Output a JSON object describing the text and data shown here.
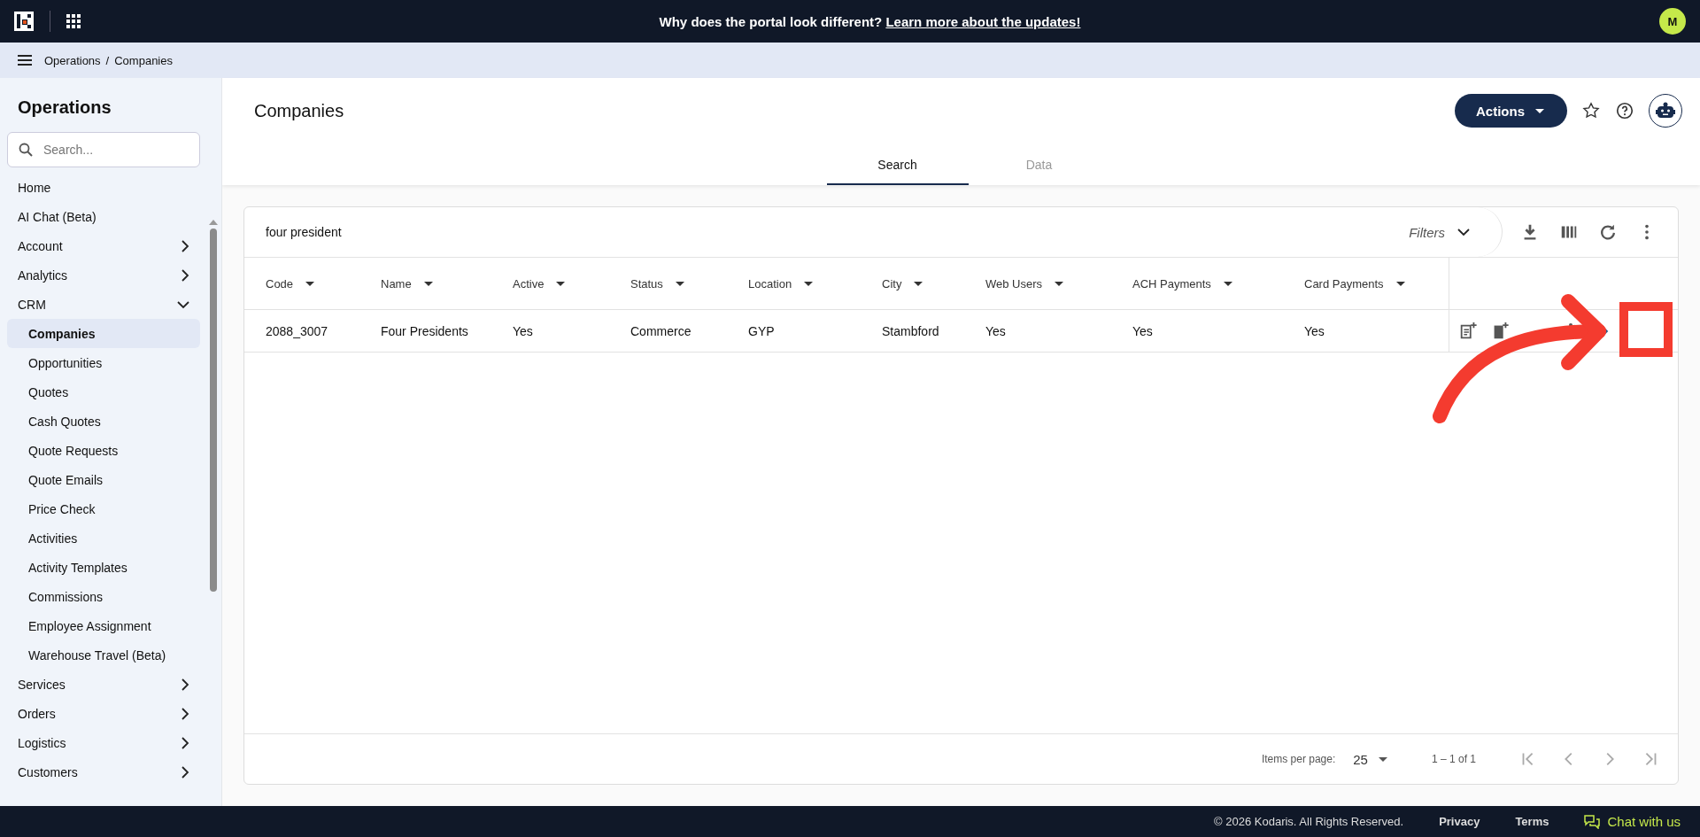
{
  "top_bar": {
    "announcement": "Why does the portal look different?",
    "link": "Learn more about the updates!",
    "avatar": "M"
  },
  "breadcrumb": {
    "items": [
      "Operations",
      "Companies"
    ],
    "separator": "/"
  },
  "sidebar": {
    "title": "Operations",
    "search_placeholder": "Search...",
    "items": [
      {
        "label": "Home",
        "kind": "link",
        "selected": false
      },
      {
        "label": "AI Chat (Beta)",
        "kind": "link",
        "selected": false
      },
      {
        "label": "Account",
        "kind": "group",
        "expanded": false,
        "selected": false
      },
      {
        "label": "Analytics",
        "kind": "group",
        "expanded": false,
        "selected": false
      },
      {
        "label": "CRM",
        "kind": "group",
        "expanded": true,
        "selected": false,
        "children": [
          {
            "label": "Companies",
            "kind": "link",
            "selected": true
          },
          {
            "label": "Opportunities",
            "kind": "link",
            "selected": false
          },
          {
            "label": "Quotes",
            "kind": "link",
            "selected": false
          },
          {
            "label": "Cash Quotes",
            "kind": "link",
            "selected": false
          },
          {
            "label": "Quote Requests",
            "kind": "link",
            "selected": false
          },
          {
            "label": "Quote Emails",
            "kind": "link",
            "selected": false
          },
          {
            "label": "Price Check",
            "kind": "link",
            "selected": false
          },
          {
            "label": "Activities",
            "kind": "link",
            "selected": false
          },
          {
            "label": "Activity Templates",
            "kind": "link",
            "selected": false
          },
          {
            "label": "Commissions",
            "kind": "link",
            "selected": false
          },
          {
            "label": "Employee Assignment",
            "kind": "link",
            "selected": false
          },
          {
            "label": "Warehouse Travel (Beta)",
            "kind": "link",
            "selected": false
          }
        ]
      },
      {
        "label": "Services",
        "kind": "group",
        "expanded": false,
        "selected": false
      },
      {
        "label": "Orders",
        "kind": "group",
        "expanded": false,
        "selected": false
      },
      {
        "label": "Logistics",
        "kind": "group",
        "expanded": false,
        "selected": false
      },
      {
        "label": "Customers",
        "kind": "group",
        "expanded": false,
        "selected": false
      }
    ]
  },
  "page": {
    "title": "Companies",
    "actions_button": "Actions",
    "tabs": [
      {
        "label": "Search",
        "selected": true
      },
      {
        "label": "Data",
        "selected": false
      }
    ]
  },
  "table": {
    "search_value": "four president",
    "filters_label": "Filters",
    "columns": [
      "Code",
      "Name",
      "Active",
      "Status",
      "Location",
      "City",
      "Web Users",
      "ACH Payments",
      "Card Payments"
    ],
    "rows": [
      {
        "cells": [
          "2088_3007",
          "Four Presidents",
          "Yes",
          "Commerce",
          "GYP",
          "Stambford",
          "Yes",
          "Yes",
          "Yes"
        ]
      }
    ]
  },
  "pagination": {
    "items_per_page_label": "Items per page:",
    "page_size": "25",
    "range": "1 – 1 of 1"
  },
  "footer": {
    "copyright": "© 2026 Kodaris. All Rights Reserved.",
    "links": [
      "Privacy",
      "Terms"
    ],
    "chat": "Chat with us"
  },
  "annotation": {
    "kind": "arrow-box"
  }
}
